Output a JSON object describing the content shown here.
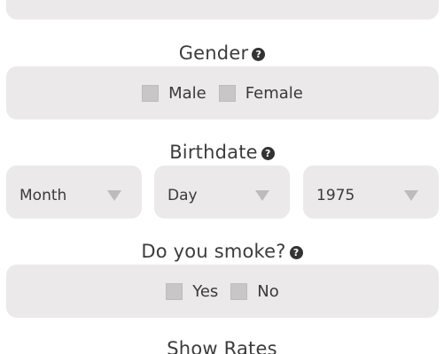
{
  "gender": {
    "title": "Gender",
    "help_icon": "question-circle-icon",
    "options": [
      {
        "label": "Male"
      },
      {
        "label": "Female"
      }
    ]
  },
  "birthdate": {
    "title": "Birthdate",
    "help_icon": "question-circle-icon",
    "month": {
      "value": "Month"
    },
    "day": {
      "value": "Day"
    },
    "year": {
      "value": "1975"
    }
  },
  "smoke": {
    "title": "Do you smoke?",
    "help_icon": "question-circle-icon",
    "options": [
      {
        "label": "Yes"
      },
      {
        "label": "No"
      }
    ]
  },
  "show_rates": {
    "label": "Show Rates"
  },
  "help_glyph": "?",
  "colors": {
    "panel_bg": "#ebe9ea",
    "checkbox": "#c8c6c7",
    "text": "#3a3a3a",
    "caret": "#bdbbbc",
    "help_icon_bg": "#333333"
  }
}
